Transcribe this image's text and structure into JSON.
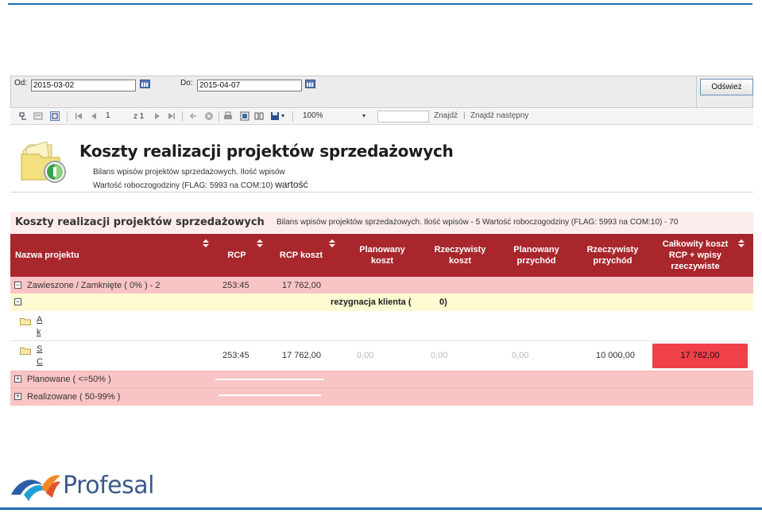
{
  "params": {
    "from_label": "Od:",
    "from_value": "2015-03-02",
    "to_label": "Do:",
    "to_value": "2015-04-07",
    "refresh_label": "Odśwież"
  },
  "toolbar": {
    "page_value": "1",
    "page_of": "z 1",
    "zoom_value": "100%",
    "find_label": "Znajdź",
    "find_next_label": "Znajdź następny",
    "divider": "|"
  },
  "report": {
    "title": "Koszty realizacji projektów sprzedażowych",
    "sub1": "Bilans wpisów projektów sprzedażowych. Ilość wpisów",
    "sub2": "Wartość roboczogodziny (FLAG: 5993 na COM:10)",
    "sub2_extra": "wartość"
  },
  "band": {
    "title": "Koszty realizacji projektów sprzedażowych",
    "info": "Bilans wpisów projektów sprzedażowych. Ilość wpisów - 5 Wartość roboczogodziny (FLAG: 5993 na COM:10) - 70"
  },
  "columns": {
    "name": "Nazwa projektu",
    "rcp": "RCP",
    "rcp_cost": "RCP koszt",
    "planned_cost": "Planowany koszt",
    "actual_cost": "Rzeczywisty koszt",
    "planned_income": "Planowany przychód",
    "actual_income": "Rzeczywisty przychód",
    "total_cost": "Całkowity koszt RCP + wpisy rzeczywiste"
  },
  "rows": {
    "group1": {
      "label": "Zawieszone / Zamknięte ( 0% ) - 2",
      "rcp": "253:45",
      "rcp_cost": "17 762,00"
    },
    "subgroup": {
      "label": "rezygnacja klienta (",
      "count": "0)"
    },
    "item1": {
      "line1": "A",
      "line2": "k"
    },
    "item2": {
      "line1": "S",
      "line2": "C",
      "rcp": "253:45",
      "rcp_cost": "17 762,00",
      "planned_cost": "0,00",
      "actual_cost": "0,00",
      "planned_income": "0,00",
      "actual_income": "10 000,00",
      "total": "17 762,00"
    },
    "group2": {
      "label": "Planowane ( <=50% )"
    },
    "group3": {
      "label": "Realizowane ( 50-99% )"
    }
  },
  "icons": {
    "expander_minus": "⊟",
    "expander_plus": "⊞",
    "expand_symbol_minus": "−",
    "expand_symbol_plus": "+"
  },
  "colors": {
    "header_red": "#a8262c",
    "group_pink": "#f9c4c4",
    "subgroup_yellow": "#fefbd2",
    "highlight_red": "#f0404a",
    "accent_blue": "#1f6fb2"
  },
  "logo": {
    "text": "Profesal"
  }
}
